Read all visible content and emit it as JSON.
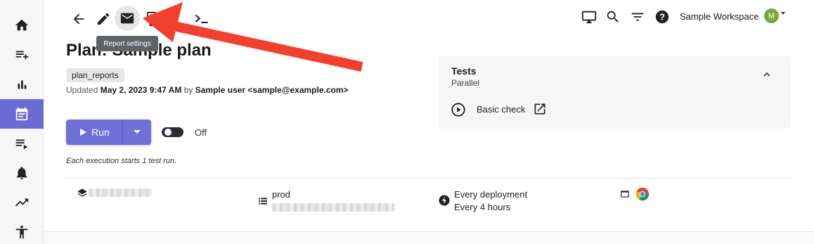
{
  "toolbar": {
    "tooltip": "Report settings",
    "icons": [
      "back-arrow-icon",
      "edit-pencil-icon",
      "mail-icon",
      "copy-icon",
      "terminal-icon"
    ]
  },
  "header_right": {
    "workspace_name": "Sample Workspace",
    "avatar_letter": "M",
    "avatar_color": "#74a83b",
    "icons": [
      "monitor-icon",
      "search-icon",
      "filter-icon",
      "help-icon"
    ]
  },
  "sidebar": {
    "items": [
      "home-icon",
      "add-list-icon",
      "bar-chart-icon",
      "calendar-icon",
      "playlist-icon",
      "bell-icon",
      "trending-up-icon",
      "accessibility-icon"
    ],
    "active_index": 3,
    "accent": "#6b6bd6"
  },
  "plan": {
    "title": "Plan: Sample plan",
    "tag": "plan_reports",
    "updated_prefix": "Updated",
    "updated_date": "May 2, 2023 9:47 AM",
    "updated_by_word": "by",
    "updated_user": "Sample user <sample@example.com>"
  },
  "run": {
    "label": "Run",
    "toggle_label": "Off",
    "note": "Each execution starts 1 test run."
  },
  "details": {
    "environment": "prod",
    "schedule_line1": "Every deployment",
    "schedule_line2": "Every 4 hours"
  },
  "tests": {
    "title": "Tests",
    "subtitle": "Parallel",
    "items": [
      {
        "label": "Basic check"
      }
    ]
  },
  "colors": {
    "primary": "#6f6fd8",
    "annotation_arrow": "#f43f2c"
  }
}
